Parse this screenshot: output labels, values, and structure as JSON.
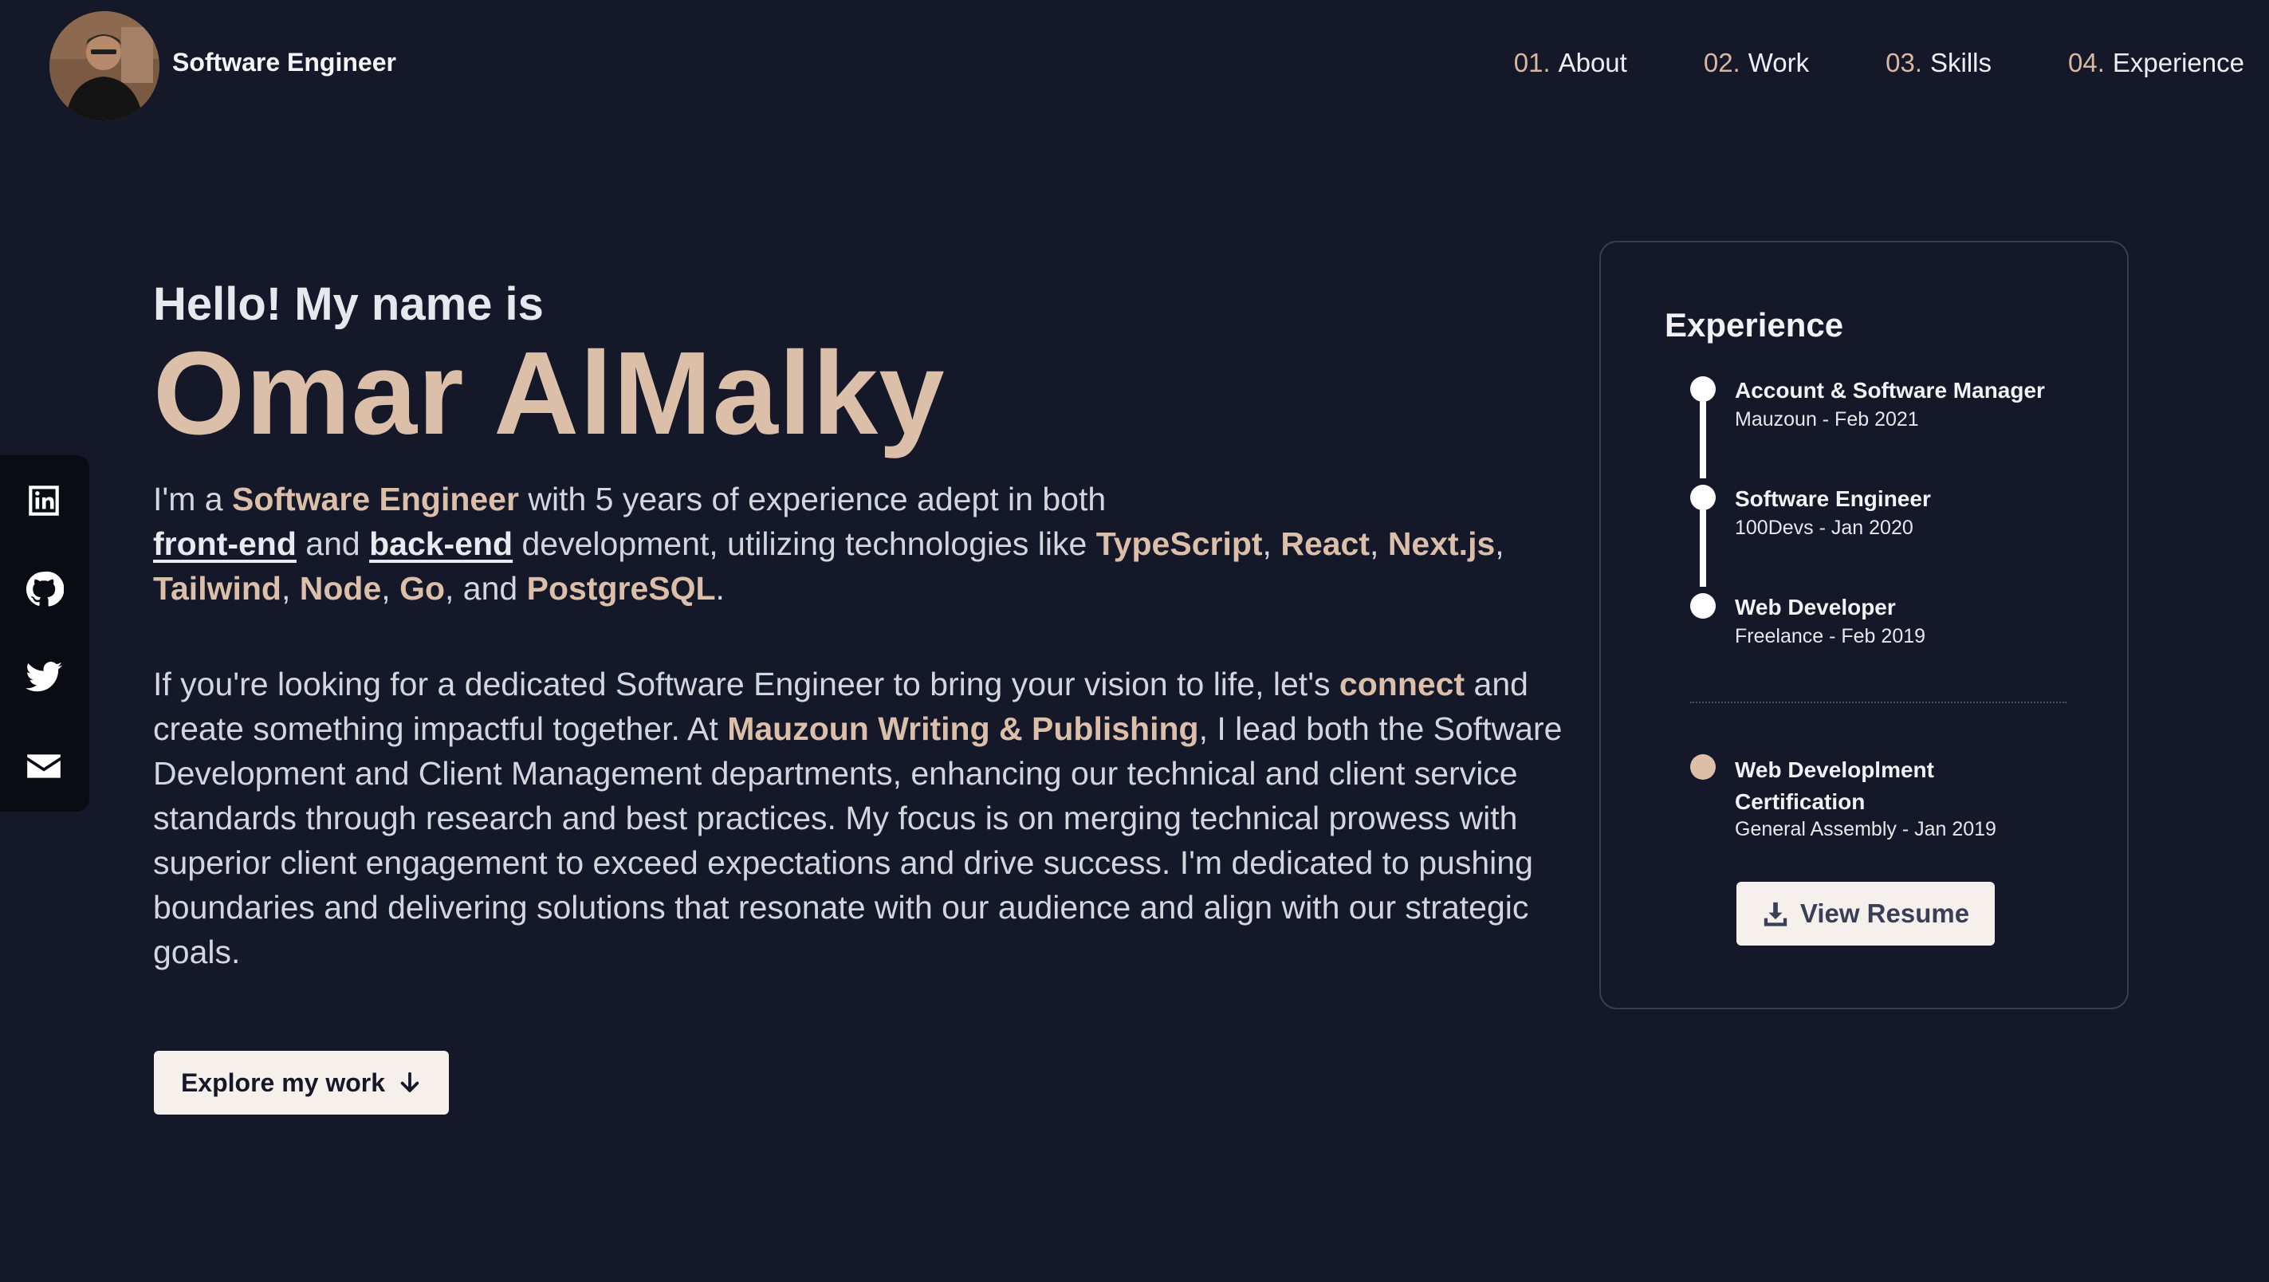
{
  "header": {
    "brand": "Software Engineer",
    "nav": [
      {
        "num": "01.",
        "label": "About"
      },
      {
        "num": "02.",
        "label": "Work"
      },
      {
        "num": "03.",
        "label": "Skills"
      },
      {
        "num": "04.",
        "label": "Experience"
      }
    ]
  },
  "social": [
    "linkedin-icon",
    "github-icon",
    "twitter-icon",
    "mail-icon"
  ],
  "hero": {
    "greeting": "Hello! My name is",
    "name": "Omar AlMalky",
    "bio1": {
      "t1": "I'm a ",
      "role": "Software Engineer",
      "t2": " with 5 years of experience adept in both ",
      "frontend": "front-end",
      "t3": " and ",
      "backend": "back-end",
      "t4": " development, utilizing technologies like ",
      "tech": [
        "TypeScript",
        "React",
        "Next.js",
        "Tailwind",
        "Node",
        "Go"
      ],
      "t5": ", and ",
      "last_tech": "PostgreSQL",
      "t6": "."
    },
    "bio2": {
      "t1": "If you're looking for a dedicated Software Engineer to bring your vision to life, let's ",
      "connect": "connect",
      "t2": " and create something impactful together. At ",
      "company": "Mauzoun Writing & Publishing",
      "t3": ", I lead both the Software Development and Client Management departments, enhancing our technical and client service standards through research and best practices. My focus is on merging technical prowess with superior client engagement to exceed expectations and drive success. I'm dedicated to pushing boundaries and delivering solutions that resonate with our audience and align with our strategic goals."
    },
    "explore_label": "Explore my work"
  },
  "experience": {
    "title": "Experience",
    "jobs": [
      {
        "title": "Account & Software Manager",
        "meta": "Mauzoun - Feb 2021"
      },
      {
        "title": "Software Engineer",
        "meta": "100Devs - Jan 2020"
      },
      {
        "title": "Web Developer",
        "meta": "Freelance - Feb 2019"
      }
    ],
    "certification": {
      "title": "Web Developlment Certification",
      "meta": "General Assembly - Jan 2019"
    },
    "resume_label": "View Resume"
  },
  "colors": {
    "background": "#151829",
    "accent": "#dcbfa9",
    "button_bg": "#f5f0ec"
  }
}
